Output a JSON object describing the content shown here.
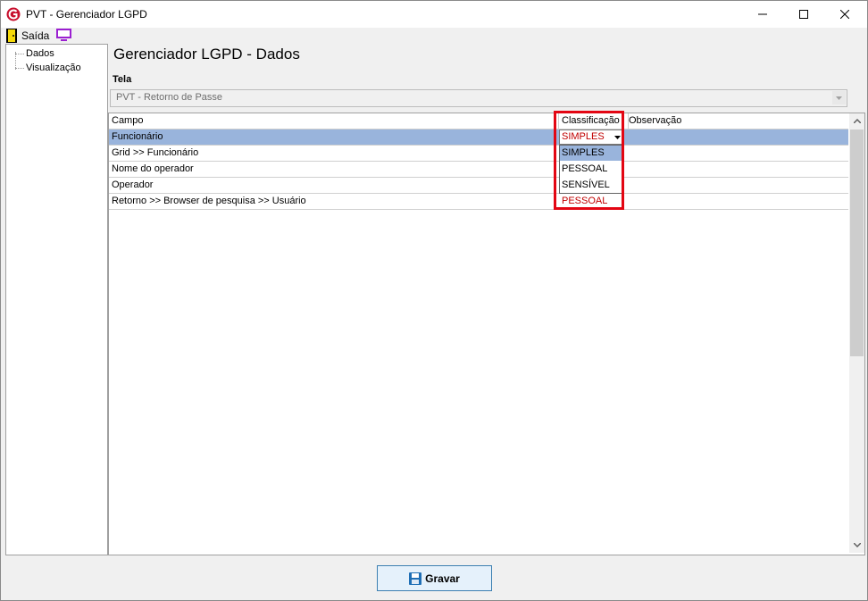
{
  "window": {
    "title": "PVT - Gerenciador LGPD"
  },
  "menu": {
    "exit_label": "Saída"
  },
  "tree": {
    "items": [
      {
        "label": "Dados"
      },
      {
        "label": "Visualização"
      }
    ]
  },
  "page": {
    "title": "Gerenciador LGPD - Dados"
  },
  "tela": {
    "label": "Tela",
    "value": "PVT - Retorno de Passe"
  },
  "grid": {
    "columns": [
      "Campo",
      "Classificação",
      "Observação"
    ],
    "rows": [
      {
        "campo": "Funcionário",
        "classificacao": "SIMPLES",
        "observacao": ""
      },
      {
        "campo": "Grid >> Funcionário",
        "classificacao": "",
        "observacao": ""
      },
      {
        "campo": "Nome do operador",
        "classificacao": "",
        "observacao": ""
      },
      {
        "campo": "Operador",
        "classificacao": "",
        "observacao": ""
      },
      {
        "campo": "Retorno >> Browser de pesquisa >> Usuário",
        "classificacao": "PESSOAL",
        "observacao": ""
      }
    ],
    "dropdown_options": [
      "SIMPLES",
      "PESSOAL",
      "SENSÍVEL"
    ],
    "dropdown_highlighted": "SIMPLES"
  },
  "actions": {
    "save_label": "Gravar"
  },
  "colors": {
    "selection": "#99b4dc",
    "highlight_border": "#e30613",
    "value_red": "#c00000"
  }
}
